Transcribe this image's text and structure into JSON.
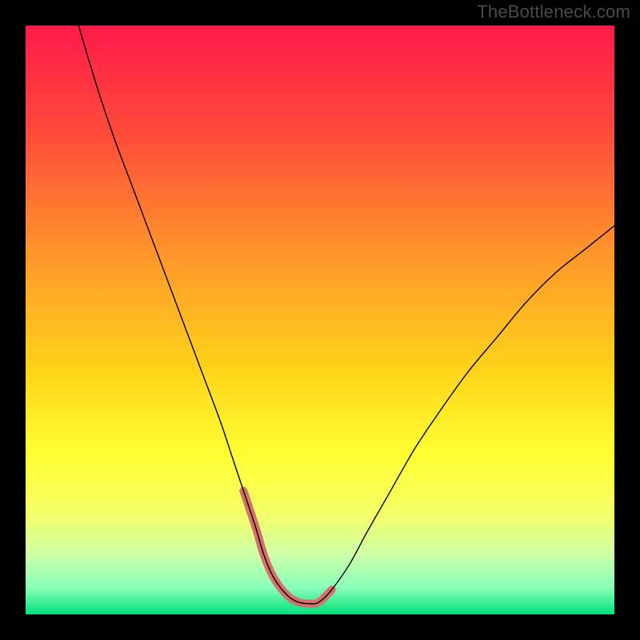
{
  "watermark": "TheBottleneck.com",
  "layout": {
    "outer_w": 800,
    "outer_h": 800,
    "inner_x": 32,
    "inner_y": 32,
    "inner_w": 736,
    "inner_h": 736
  },
  "chart_data": {
    "type": "line",
    "title": "",
    "xlabel": "",
    "ylabel": "",
    "xlim": [
      0,
      100
    ],
    "ylim": [
      0,
      100
    ],
    "grid": false,
    "legend": false,
    "gradient_stops": [
      {
        "offset": 0.0,
        "color": "#ff1a4b"
      },
      {
        "offset": 0.18,
        "color": "#ff4a3a"
      },
      {
        "offset": 0.4,
        "color": "#ff9a2a"
      },
      {
        "offset": 0.58,
        "color": "#ffd21a"
      },
      {
        "offset": 0.73,
        "color": "#ffff33"
      },
      {
        "offset": 0.83,
        "color": "#f5ff66"
      },
      {
        "offset": 0.9,
        "color": "#ccffaa"
      },
      {
        "offset": 0.955,
        "color": "#88ffbb"
      },
      {
        "offset": 1.0,
        "color": "#00e07a"
      }
    ],
    "series": [
      {
        "name": "curve",
        "color": "#000000",
        "width": 1.4,
        "x": [
          9,
          12,
          15,
          18,
          21,
          24,
          27,
          30,
          33,
          35,
          37,
          39,
          40.5,
          42,
          44,
          46,
          48.5,
          50,
          52,
          55,
          58,
          62,
          66,
          70,
          75,
          80,
          85,
          90,
          95,
          100
        ],
        "y": [
          100,
          90,
          81,
          73,
          65,
          57,
          49,
          41,
          33,
          27,
          21,
          15,
          10,
          6.5,
          3.7,
          2.2,
          1.8,
          2.2,
          4.2,
          8.5,
          14,
          21,
          28,
          34,
          41,
          47,
          53,
          58,
          62,
          66
        ]
      },
      {
        "name": "highlight",
        "color": "#d6706b",
        "width": 10,
        "linecap": "round",
        "x": [
          37,
          39,
          40.5,
          42,
          44,
          46,
          48.5,
          50,
          52
        ],
        "y": [
          21,
          15,
          10,
          6.5,
          3.7,
          2.2,
          1.8,
          2.2,
          4.2
        ]
      }
    ]
  }
}
